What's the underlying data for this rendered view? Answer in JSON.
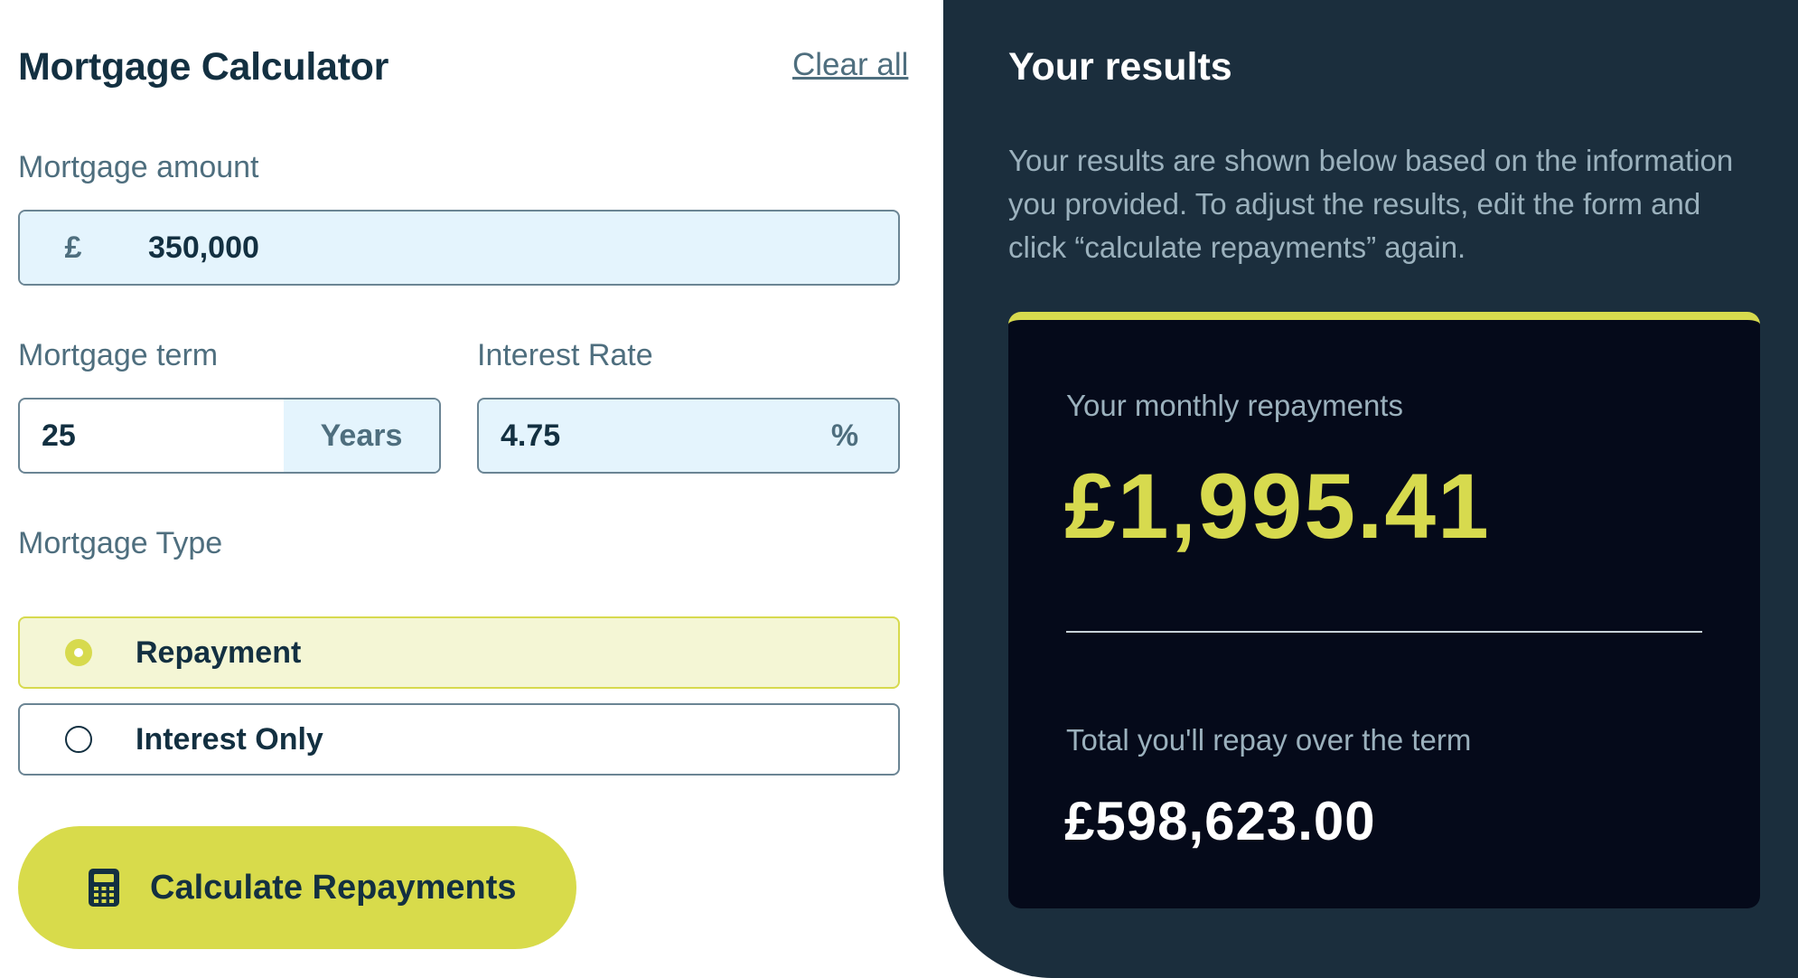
{
  "calculator": {
    "title": "Mortgage Calculator",
    "clear_all": "Clear all",
    "amount": {
      "label": "Mortgage amount",
      "prefix": "£",
      "value": "350,000"
    },
    "term": {
      "label": "Mortgage term",
      "value": "25",
      "suffix": "Years"
    },
    "rate": {
      "label": "Interest Rate",
      "value": "4.75",
      "suffix": "%"
    },
    "type": {
      "label": "Mortgage Type",
      "options": [
        {
          "label": "Repayment",
          "selected": true
        },
        {
          "label": "Interest Only",
          "selected": false
        }
      ]
    },
    "button_label": "Calculate Repayments",
    "button_icon": "calculator-icon"
  },
  "results": {
    "title": "Your results",
    "description": "Your results are shown below based on the information you provided. To adjust the results, edit the form and click “calculate repayments” again.",
    "monthly_label": "Your monthly repayments",
    "monthly_value": "£1,995.41",
    "total_label": "Total you'll repay over the term",
    "total_value": "£598,623.00"
  },
  "colors": {
    "accent_lime": "#d7da4e",
    "dark_panel": "#1b2e3d",
    "card_bg": "#050a1a",
    "input_tint": "#e4f4fd"
  }
}
